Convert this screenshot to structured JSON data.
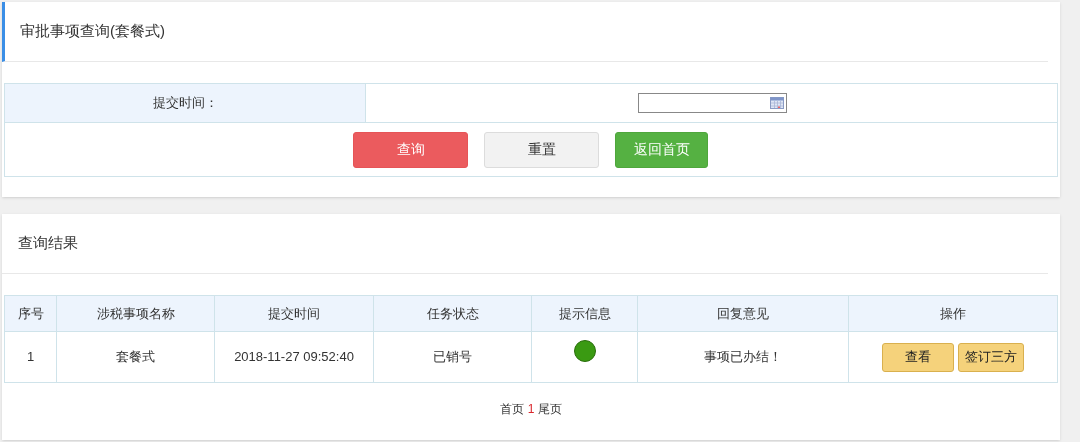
{
  "search_panel": {
    "title": "审批事项查询(套餐式)",
    "field": {
      "label": "提交时间："
    },
    "buttons": [
      {
        "label": "查询",
        "kind": "danger"
      },
      {
        "label": "重置",
        "kind": "default"
      },
      {
        "label": "返回首页",
        "kind": "success"
      }
    ]
  },
  "results_panel": {
    "title": "查询结果",
    "table": {
      "columns": [
        "序号",
        "涉税事项名称",
        "提交时间",
        "任务状态",
        "提示信息",
        "回复意见",
        "操作"
      ],
      "rows": [
        {
          "index": "1",
          "name": "套餐式",
          "submitted": "2018-11-27 09:52:40",
          "status": "已销号",
          "color": "#3a9a12",
          "reply": "事项已办结！",
          "actions": [
            "查看",
            "签订三方"
          ]
        }
      ]
    },
    "pagination": {
      "first": "首页",
      "pages": [
        {
          "label": "1",
          "selected": true
        }
      ],
      "last": "尾页"
    }
  }
}
